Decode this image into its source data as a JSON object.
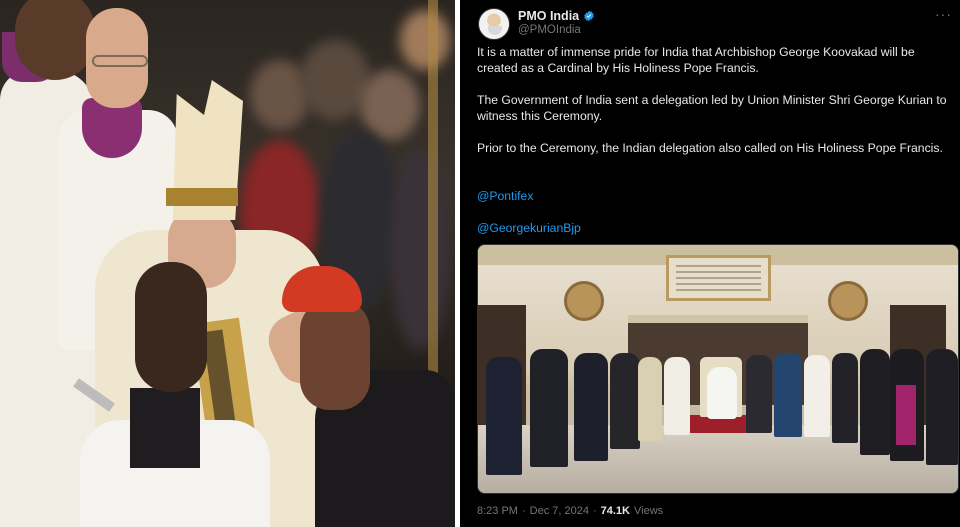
{
  "tweet": {
    "author": {
      "display_name": "PMO India",
      "handle": "@PMOIndia",
      "verified": true
    },
    "paragraphs": [
      "It is a matter of immense pride for India that Archbishop George Koovakad will be created as a Cardinal by His Holiness Pope Francis.",
      "The Government of India sent a delegation led by Union Minister Shri George Kurian to witness this Ceremony.",
      "Prior to the Ceremony, the Indian delegation also called on His Holiness Pope Francis."
    ],
    "mentions": [
      "@Pontifex",
      "@GeorgekurianBjp"
    ],
    "footer": {
      "time": "8:23 PM",
      "separator": "·",
      "date": "Dec 7, 2024",
      "views_count": "74.1K",
      "views_label": "Views"
    },
    "colors": {
      "background": "#000000",
      "text": "#e7e9ea",
      "muted": "#71767b",
      "link": "#1d9bf0",
      "verified": "#1d9bf0"
    },
    "icons": [
      "more-options-icon",
      "verified-badge-icon"
    ]
  }
}
